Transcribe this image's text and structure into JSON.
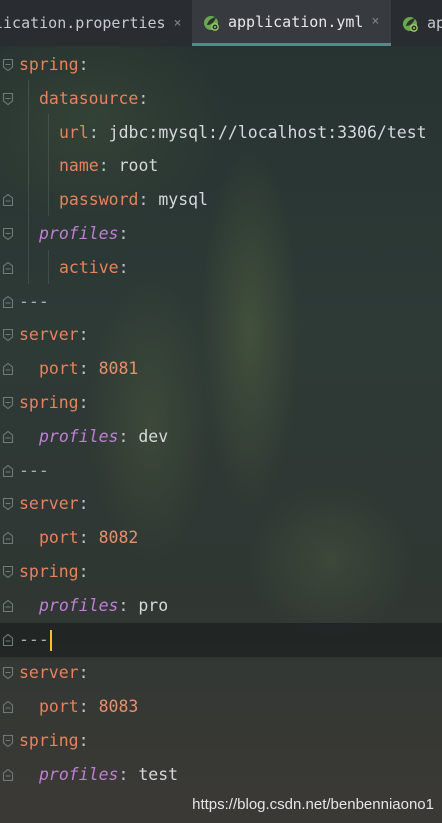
{
  "tabs": [
    {
      "label": "lication.properties",
      "close": "×",
      "active": false
    },
    {
      "label": "application.yml",
      "close": "×",
      "active": true
    },
    {
      "label": "ap",
      "active": false
    }
  ],
  "lines": [
    {
      "key": "spring",
      "sep": ":",
      "value": ""
    },
    {
      "key": "datasource",
      "sep": ":",
      "value": ""
    },
    {
      "key": "url",
      "sep": ":",
      "value": " jdbc:mysql://localhost:3306/test"
    },
    {
      "key": "name",
      "sep": ":",
      "value": " root"
    },
    {
      "key": "password",
      "sep": ":",
      "value": " mysql"
    },
    {
      "key": "profiles",
      "sep": ":",
      "value": ""
    },
    {
      "key": "active",
      "sep": ":",
      "value": ""
    },
    {
      "text": "---"
    },
    {
      "key": "server",
      "sep": ":",
      "value": ""
    },
    {
      "key": "port",
      "sep": ":",
      "value": " 8081"
    },
    {
      "key": "spring",
      "sep": ":",
      "value": ""
    },
    {
      "key": "profiles",
      "sep": ":",
      "value": " dev"
    },
    {
      "text": "---"
    },
    {
      "key": "server",
      "sep": ":",
      "value": ""
    },
    {
      "key": "port",
      "sep": ":",
      "value": " 8082"
    },
    {
      "key": "spring",
      "sep": ":",
      "value": ""
    },
    {
      "key": "profiles",
      "sep": ":",
      "value": " pro"
    },
    {
      "text": "---"
    },
    {
      "key": "server",
      "sep": ":",
      "value": ""
    },
    {
      "key": "port",
      "sep": ":",
      "value": " 8083"
    },
    {
      "key": "spring",
      "sep": ":",
      "value": ""
    },
    {
      "key": "profiles",
      "sep": ":",
      "value": " test"
    }
  ],
  "watermark": "https://blog.csdn.net/benbenniaono1",
  "colors": {
    "key": "#e8825b",
    "profiles_key": "#c07ed6",
    "number": "#e8906a",
    "caret": "#f2c230",
    "active_tab_underline": "#4b8f8c"
  }
}
